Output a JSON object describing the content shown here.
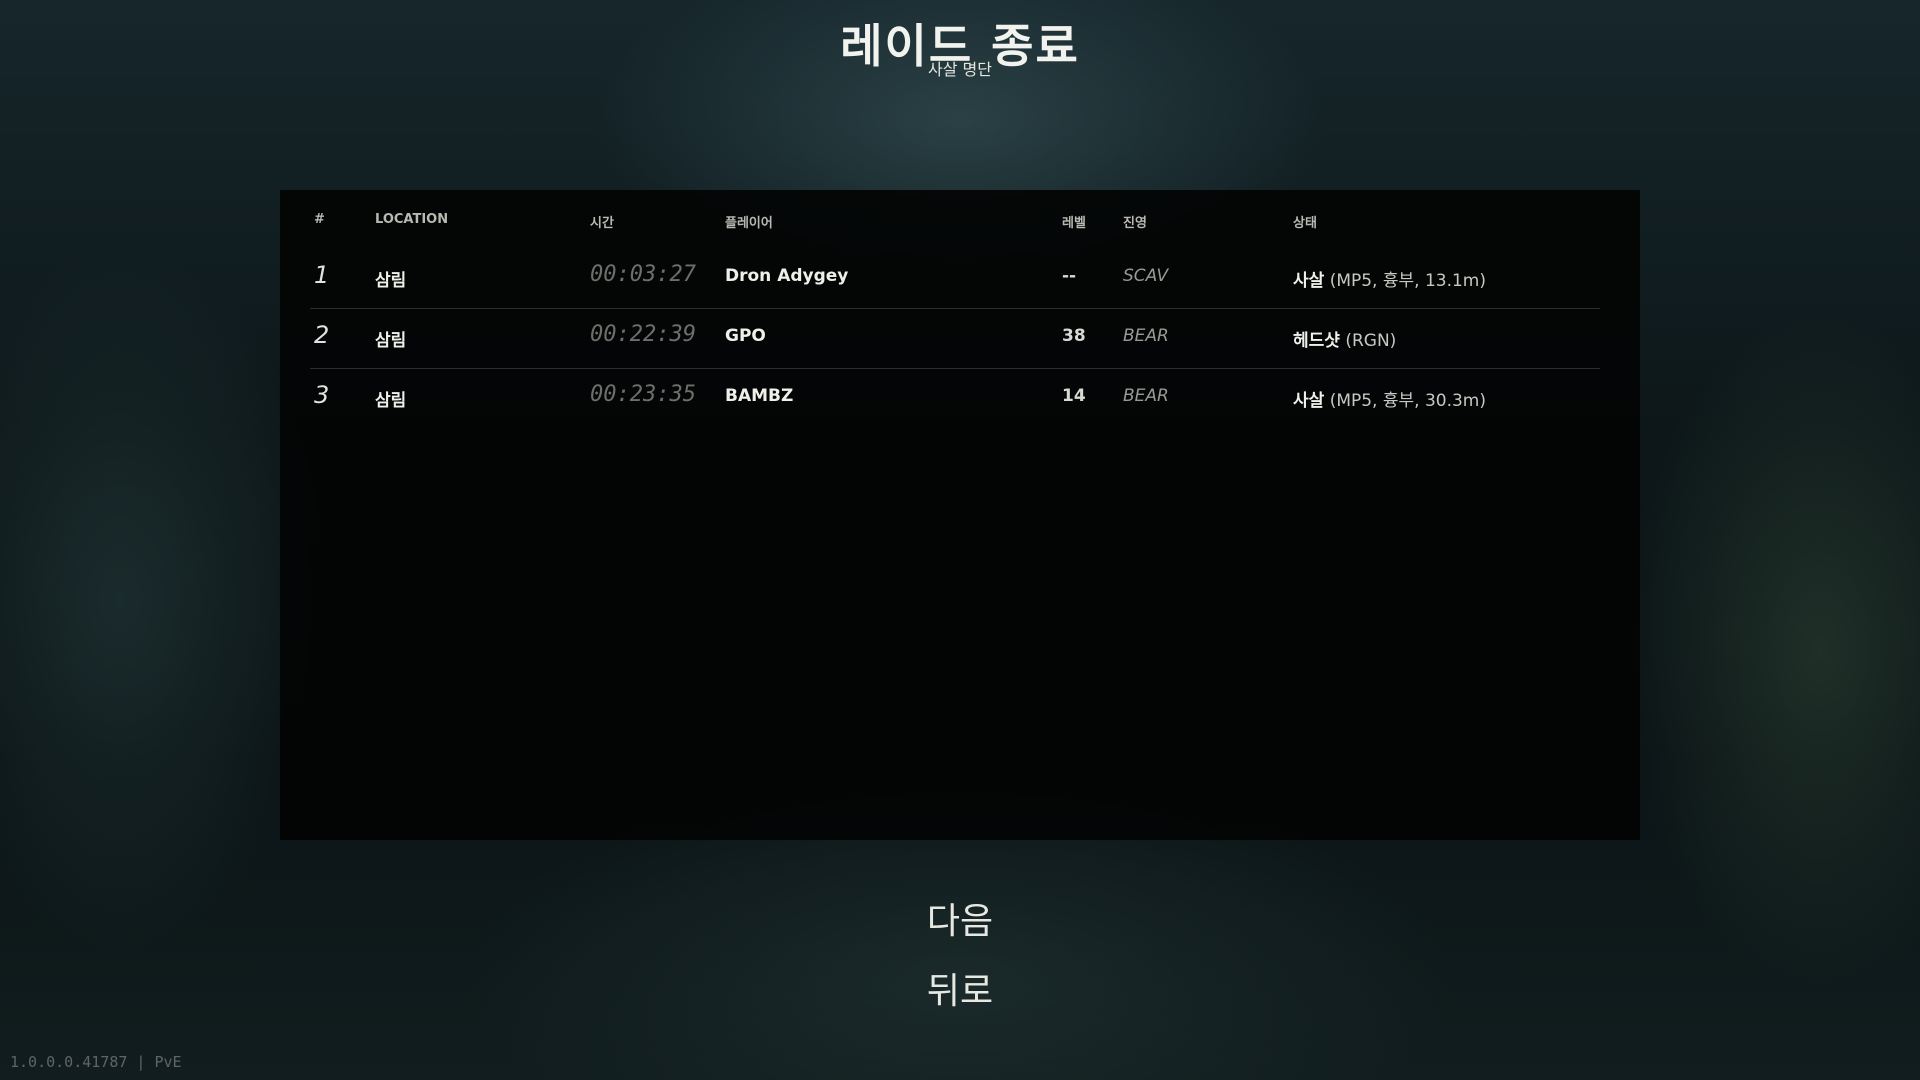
{
  "header": {
    "title": "레이드 종료",
    "subtitle": "사살 명단"
  },
  "table": {
    "columns": {
      "index": "#",
      "location": "LOCATION",
      "time": "시간",
      "player": "플레이어",
      "level": "레벨",
      "faction": "진영",
      "status": "상태"
    },
    "rows": [
      {
        "index": "1",
        "location": "삼림",
        "time": "00:03:27",
        "player": "Dron Adygey",
        "level": "--",
        "faction": "SCAV",
        "status_main": "사살",
        "status_detail": "(MP5, 흉부, 13.1m)"
      },
      {
        "index": "2",
        "location": "삼림",
        "time": "00:22:39",
        "player": "GPO",
        "level": "38",
        "faction": "BEAR",
        "status_main": "헤드샷",
        "status_detail": "(RGN)"
      },
      {
        "index": "3",
        "location": "삼림",
        "time": "00:23:35",
        "player": "BAMBZ",
        "level": "14",
        "faction": "BEAR",
        "status_main": "사살",
        "status_detail": "(MP5, 흉부, 30.3m)"
      }
    ]
  },
  "menu": {
    "next_label": "다음",
    "back_label": "뒤로"
  },
  "footer": {
    "version": "1.0.0.0.41787 | PvE"
  }
}
